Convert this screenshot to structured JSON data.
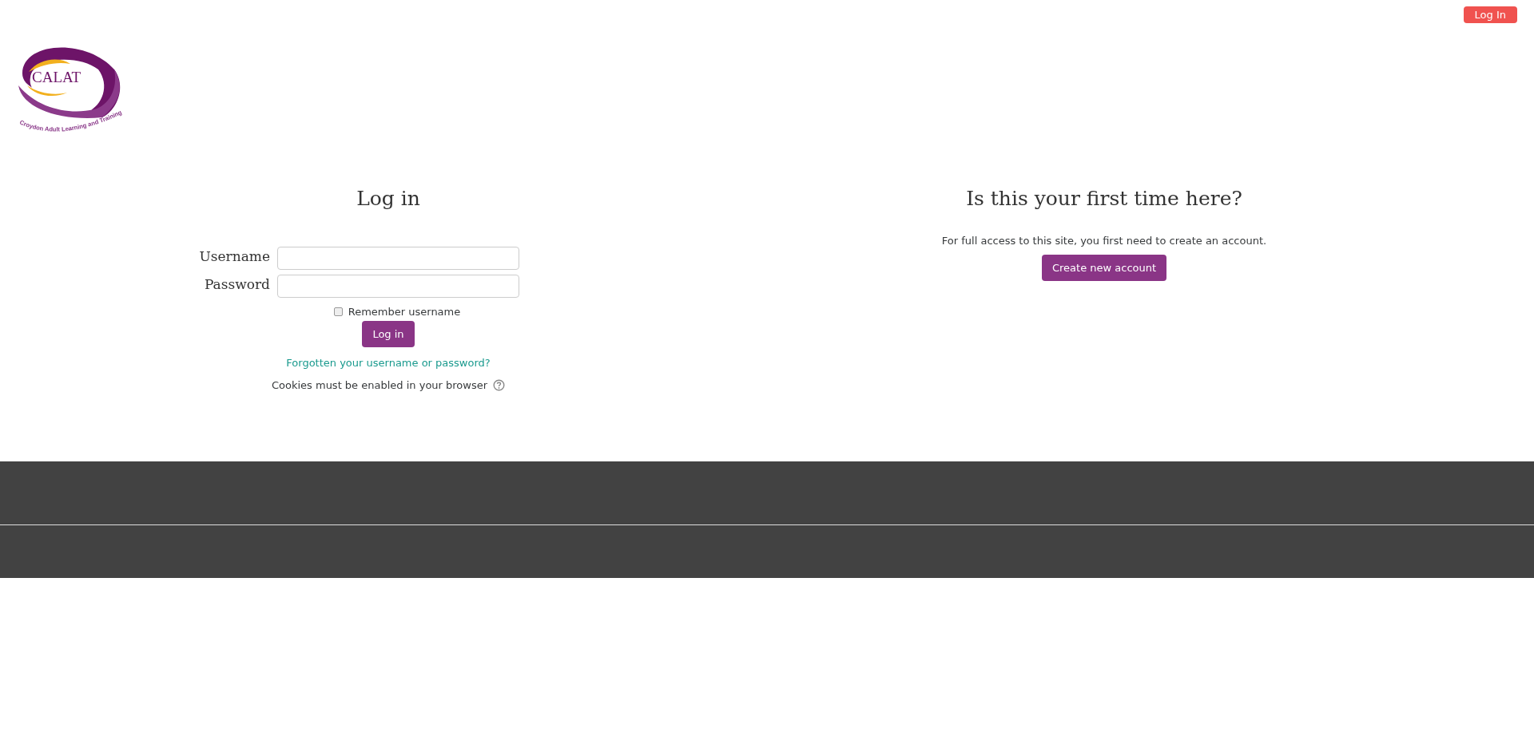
{
  "header": {
    "login_button": "Log In",
    "logo": {
      "name": "CALAT",
      "tagline": "Croydon Adult Learning and Training"
    }
  },
  "login": {
    "title": "Log in",
    "fields": [
      {
        "label": "Username"
      },
      {
        "label": "Password"
      }
    ],
    "remember": {
      "label": "Remember username",
      "checked": false
    },
    "submit": "Log in",
    "forgot_link": "Forgotten your username or password?",
    "cookies_note": "Cookies must be enabled in your browser"
  },
  "signup": {
    "title": "Is this your first time here?",
    "text": "For full access to this site, you first need to create an account.",
    "button": "Create new account"
  }
}
